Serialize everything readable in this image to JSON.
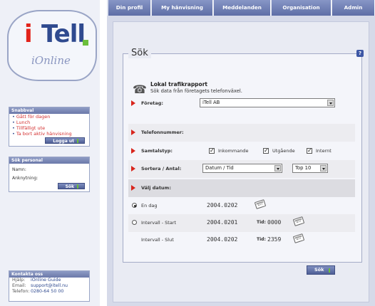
{
  "logo": {
    "i": "i",
    "tell": "Tell",
    "online": "iOnline"
  },
  "snabbval": {
    "title": "Snabbval",
    "items": [
      "Gått för dagen",
      "Lunch",
      "Tillfälligt ute",
      "Ta bort aktiv hänvisning"
    ],
    "logout_label": "Logga ut"
  },
  "sok_personal": {
    "title": "Sök personal",
    "name_label": "Namn:",
    "ext_label": "Anknytning:",
    "button_label": "Sök"
  },
  "kontakt": {
    "title": "Kontakta oss",
    "rows": [
      {
        "key": "Hjälp:",
        "value": "iOnline Guide"
      },
      {
        "key": "Email:",
        "value": "support@itell.nu"
      },
      {
        "key": "Telefon:",
        "value": "0280-64 50 00"
      }
    ]
  },
  "tabs": [
    "Din profil",
    "My hänvisning",
    "Meddelanden",
    "Organisation",
    "Admin"
  ],
  "sok": {
    "title": "Sök",
    "help": "?",
    "report_title": "Lokal trafikrapport",
    "report_sub": "Sök data från företagets telefonväxel.",
    "foretag_label": "Företag:",
    "foretag_value": "iTell AB",
    "telefonnummer_label": "Telefonnummer:",
    "samtalstyp_label": "Samtalstyp:",
    "samtalstyp_options": [
      {
        "label": "Inkommande",
        "checked": true
      },
      {
        "label": "Utgående",
        "checked": true
      },
      {
        "label": "Internt",
        "checked": true
      }
    ],
    "sortera_label": "Sortera / Antal:",
    "sortera_value": "Datum / Tid",
    "antal_value": "Top 10",
    "valj_datum_label": "Välj datum:",
    "en_dag_label": "En dag",
    "en_dag_date": "2004.0202",
    "intervall_start_label": "Intervall - Start",
    "intervall_start_date": "2004.0201",
    "intervall_start_tid": "0000",
    "intervall_slut_label": "Intervall - Slut",
    "intervall_slut_date": "2004.0202",
    "intervall_slut_tid": "2359",
    "tid_label": "Tid:",
    "button_label": "Sök"
  }
}
